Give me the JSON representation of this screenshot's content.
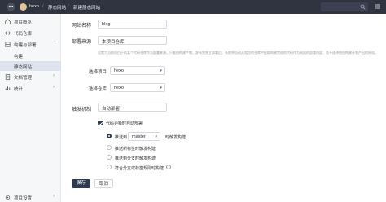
{
  "topbar": {
    "crumbs": [
      "hexo",
      "静态网站",
      "新建静态网站"
    ],
    "separator": "/"
  },
  "sidebar": {
    "items": [
      {
        "label": "项目概览",
        "icon": "home-icon"
      },
      {
        "label": "代码仓库",
        "icon": "code-icon"
      },
      {
        "label": "构建与部署",
        "icon": "build-icon",
        "expanded": true
      },
      {
        "label": "构建",
        "sub": true
      },
      {
        "label": "静态网站",
        "sub": true,
        "active": true
      },
      {
        "label": "文档管理",
        "icon": "doc-icon"
      },
      {
        "label": "统计",
        "icon": "stats-icon"
      }
    ],
    "footer": "项目设置"
  },
  "form": {
    "site_name_label": "网站名称",
    "site_name_value": "blog",
    "source_label": "部署来源",
    "source_value": "本项目仓库",
    "hint": "设置为当前项目下的某个代码仓库作为部署来源。只能由构建产物，发布到独立部署后，系统将自动从相应的仓库中拉取构建完成的代码作为网站的部署内容；若不选择则由构建计划产出的网站。",
    "project_label": "选择项目",
    "project_value": "hexo",
    "repo_label": "选择仓库",
    "repo_value": "hexo",
    "trigger_label": "触发机制",
    "trigger_value": "自动部署",
    "auto_deploy_checkbox": "代码更新时自动部署",
    "radio_push_prefix": "推送到",
    "radio_push_branch": "master",
    "radio_push_suffix": "时触发构建",
    "radio_tag": "推送新标签时触发构建",
    "radio_branch": "推送到分支时触发构建",
    "radio_custom": "符合分支或标签规则时构建",
    "help": "?"
  },
  "actions": {
    "save": "保存",
    "cancel": "取消"
  }
}
